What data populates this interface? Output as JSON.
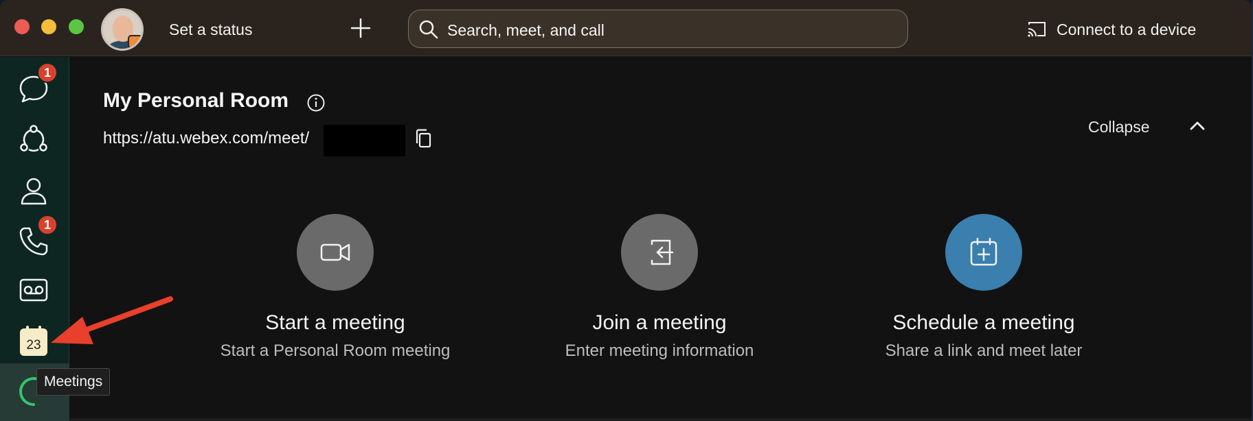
{
  "titlebar": {
    "status_label": "Set a status",
    "search_placeholder": "Search, meet, and call",
    "connect_label": "Connect to a device"
  },
  "sidebar": {
    "items": [
      {
        "name": "messaging",
        "icon": "chat-bubble-icon",
        "badge": "1"
      },
      {
        "name": "teams",
        "icon": "teams-icon"
      },
      {
        "name": "contacts",
        "icon": "person-icon"
      },
      {
        "name": "calling",
        "icon": "phone-icon",
        "badge": "1"
      },
      {
        "name": "voicemail",
        "icon": "voicemail-icon"
      },
      {
        "name": "meetings",
        "icon": "calendar-icon",
        "calendar_day": "23"
      }
    ],
    "tooltip": "Meetings"
  },
  "room": {
    "title": "My Personal Room",
    "url": "https://atu.webex.com/meet/",
    "collapse_label": "Collapse"
  },
  "actions": [
    {
      "title": "Start a meeting",
      "subtitle": "Start a Personal Room meeting",
      "icon": "video-camera-icon",
      "color": "#6a6a6a"
    },
    {
      "title": "Join a meeting",
      "subtitle": "Enter meeting information",
      "icon": "join-door-icon",
      "color": "#6a6a6a"
    },
    {
      "title": "Schedule a meeting",
      "subtitle": "Share a link and meet later",
      "icon": "calendar-add-icon",
      "color": "#3a7fad"
    }
  ],
  "colors": {
    "titlebar": "#2b241e",
    "sidebar": "#0e2622",
    "badge": "#d9412d",
    "annotation_arrow": "#e8402c"
  }
}
